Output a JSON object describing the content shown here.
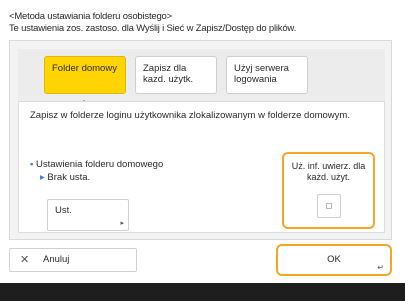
{
  "header": {
    "line1": "<Metoda ustawiania folderu osobistego>",
    "line2": "Te ustawienia zos. zastoso. dla Wyślij i Sieć w Zapisz/Dostęp do plików."
  },
  "tabs": [
    {
      "label": "Folder domowy",
      "selected": true
    },
    {
      "label": "Zapisz dla kazd. użytk.",
      "selected": false
    },
    {
      "label": "Użyj serwera logowania",
      "selected": false
    }
  ],
  "content": {
    "description": "Zapisz w folderze loginu użytkownika zlokalizowanym w folderze domowym.",
    "setting_label": "Ustawienia folderu domowego",
    "setting_value": "Brak usta.",
    "settings_button": "Ust.",
    "toggle_label": "Uż. inf. uwierz. dla każd. użyt.",
    "toggle_checked": false
  },
  "footer": {
    "cancel_label": "Anuluj",
    "ok_label": "OK"
  },
  "colors": {
    "accent": "#ffd400",
    "highlight_border": "#f5a623",
    "indicator": "#1a63c9"
  }
}
